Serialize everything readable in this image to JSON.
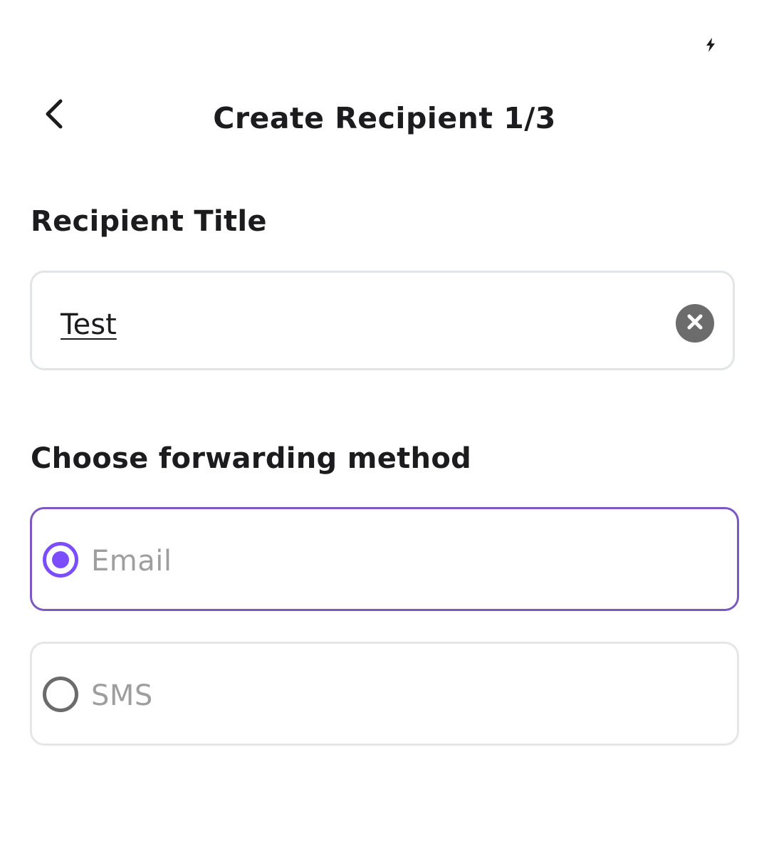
{
  "status_bar": {
    "icon": "lightning-bolt-icon"
  },
  "header": {
    "back_icon": "chevron-left-icon",
    "title": "Create Recipient 1/3"
  },
  "recipient_title": {
    "label": "Recipient Title",
    "value": "Test",
    "clear_icon": "close-circle-icon"
  },
  "forwarding": {
    "label": "Choose forwarding method",
    "options": [
      {
        "label": "Email",
        "selected": true
      },
      {
        "label": "SMS",
        "selected": false
      }
    ]
  },
  "colors": {
    "accent": "#7c4dff",
    "selected_border": "#7e57c2",
    "field_border": "#e1e5e8",
    "option_label": "#9e9e9e",
    "text": "#1c1c1e"
  }
}
